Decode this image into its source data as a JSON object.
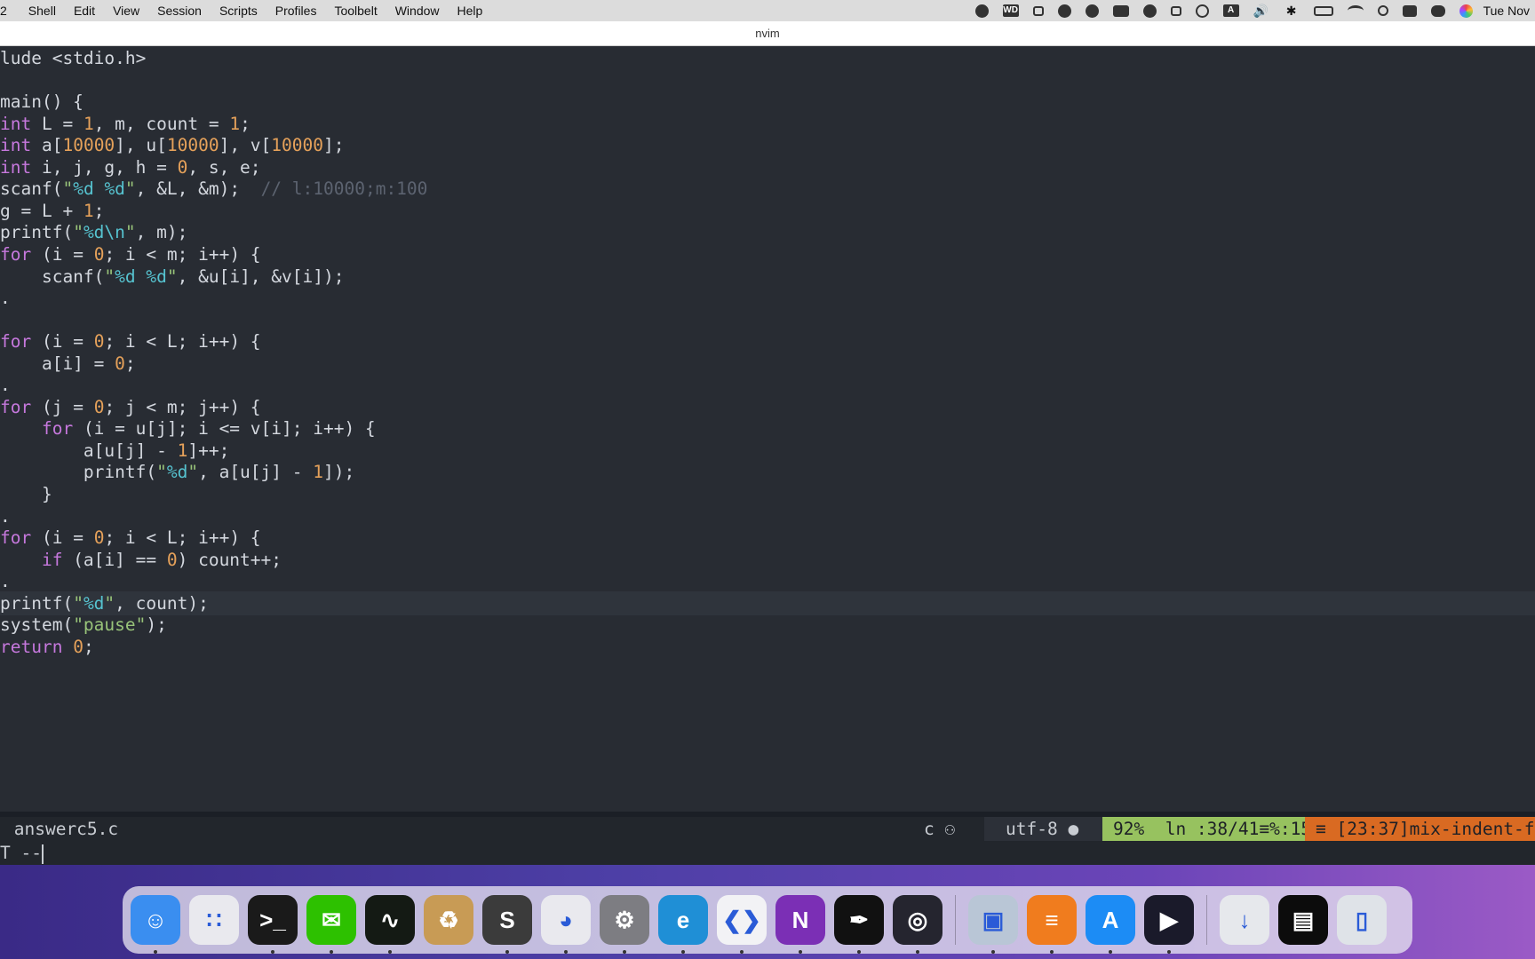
{
  "menubar": {
    "app_fragment": "2",
    "items": [
      "Shell",
      "Edit",
      "View",
      "Session",
      "Scripts",
      "Profiles",
      "Toolbelt",
      "Window",
      "Help"
    ],
    "status_icons": [
      "screen-capture-icon",
      "wd-drive-icon",
      "snowflake-icon",
      "teacup-icon",
      "moon-face-icon",
      "keyboard-icon",
      "bell-icon",
      "square-icon",
      "play-circle-icon",
      "input-a-icon",
      "volume-icon",
      "bluetooth-icon",
      "battery-icon",
      "wifi-icon",
      "search-icon",
      "keyboard-layout-icon",
      "control-center-icon",
      "siri-icon"
    ],
    "wd_label": "WD",
    "input_label": "A",
    "clock": "Tue Nov"
  },
  "window": {
    "title": "nvim"
  },
  "editor": {
    "lines": [
      {
        "t": "lude <stdio.h>"
      },
      {
        "t": ""
      },
      {
        "t": "main() {"
      },
      {
        "t": "int L = 1, m, count = 1;"
      },
      {
        "t": "int a[10000], u[10000], v[10000];"
      },
      {
        "t": "int i, j, g, h = 0, s, e;"
      },
      {
        "t": "scanf(\"%d %d\", &L, &m);  // l:10000;m:100"
      },
      {
        "t": "g = L + 1;"
      },
      {
        "t": "printf(\"%d\\n\", m);"
      },
      {
        "t": "for (i = 0; i < m; i++) {"
      },
      {
        "t": "    scanf(\"%d %d\", &u[i], &v[i]);"
      },
      {
        "t": "."
      },
      {
        "t": ""
      },
      {
        "t": "for (i = 0; i < L; i++) {"
      },
      {
        "t": "    a[i] = 0;"
      },
      {
        "t": "."
      },
      {
        "t": "for (j = 0; j < m; j++) {"
      },
      {
        "t": "    for (i = u[j]; i <= v[i]; i++) {"
      },
      {
        "t": "        a[u[j] - 1]++;"
      },
      {
        "t": "        printf(\"%d\", a[u[j] - 1]);"
      },
      {
        "t": "    }"
      },
      {
        "t": "."
      },
      {
        "t": "for (i = 0; i < L; i++) {"
      },
      {
        "t": "    if (a[i] == 0) count++;"
      },
      {
        "t": "."
      },
      {
        "t": "printf(\"%d\", count);"
      },
      {
        "t": "system(\"pause\");"
      },
      {
        "t": "return 0;"
      }
    ],
    "current_line_index": 25
  },
  "statusline": {
    "file": " answerc5.c",
    "filetype": "c ",
    "encoding": "utf-8 ",
    "position": "92%  ln :38/41≡%:15",
    "warning": "≡ [23:37]mix-indent-f"
  },
  "cmdline": {
    "text": "T --"
  },
  "dock": {
    "items": [
      {
        "name": "finder-icon",
        "bg": "#3a8ef0",
        "running": true
      },
      {
        "name": "launchpad-icon",
        "bg": "#e9e9ee",
        "running": false
      },
      {
        "name": "terminal-icon",
        "bg": "#1a1a1a",
        "running": true
      },
      {
        "name": "wechat-icon",
        "bg": "#2dc100",
        "running": true
      },
      {
        "name": "activity-monitor-icon",
        "bg": "#141a14",
        "running": true
      },
      {
        "name": "archive-utility-icon",
        "bg": "#c89b55",
        "running": false
      },
      {
        "name": "sublime-text-icon",
        "bg": "#3b3b3b",
        "running": true
      },
      {
        "name": "qq-icon",
        "bg": "#e9e9ee",
        "running": true
      },
      {
        "name": "system-preferences-icon",
        "bg": "#7d7d82",
        "running": true
      },
      {
        "name": "edge-icon",
        "bg": "#1f8fd6",
        "running": true
      },
      {
        "name": "vscode-icon",
        "bg": "#f2f2f5",
        "running": true
      },
      {
        "name": "onenote-icon",
        "bg": "#7b2fb5",
        "running": true
      },
      {
        "name": "pen-tool-icon",
        "bg": "#111111",
        "running": true
      },
      {
        "name": "obs-icon",
        "bg": "#25252f",
        "running": true
      },
      {
        "name": "preview-icon",
        "bg": "#b9c6d6",
        "running": true
      },
      {
        "name": "books-icon",
        "bg": "#f07c1e",
        "running": true
      },
      {
        "name": "app-store-icon",
        "bg": "#1c8cf5",
        "running": true
      },
      {
        "name": "infuse-icon",
        "bg": "#1a1a2a",
        "running": true
      },
      {
        "name": "downloads-folder-icon",
        "bg": "#e6e8ec",
        "running": false
      },
      {
        "name": "terminal-window-icon",
        "bg": "#0c0c0c",
        "running": false
      },
      {
        "name": "trash-icon",
        "bg": "#dfe3e8",
        "running": false
      }
    ]
  }
}
